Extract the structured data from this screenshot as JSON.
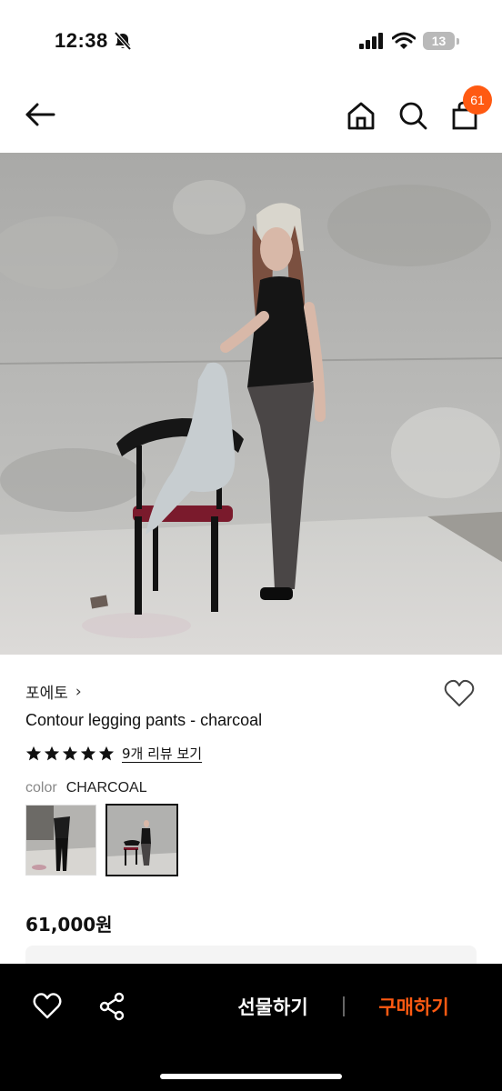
{
  "status_bar": {
    "time": "12:38",
    "battery": "13",
    "icons": [
      "bell-slash-icon",
      "cellular-signal-icon",
      "wifi-icon",
      "battery-icon"
    ]
  },
  "nav": {
    "icons": [
      "back-arrow-icon",
      "home-icon",
      "search-icon",
      "shopping-bag-icon"
    ],
    "cart_count": "61",
    "badge_color": "#ff5a12"
  },
  "product": {
    "brand": "포에토",
    "brand_chevron": "›",
    "title": "Contour legging pants - charcoal",
    "rating_stars": 5,
    "review_link": "9개 리뷰 보기",
    "color_label": "color",
    "color_value": "CHARCOAL",
    "thumbnail_selected_index": 1,
    "price": "61,000원"
  },
  "bottom_bar": {
    "gift_label": "선물하기",
    "buy_label": "구매하기",
    "accent_color": "#ff5a12",
    "icons": [
      "heart-icon",
      "share-icon"
    ]
  }
}
